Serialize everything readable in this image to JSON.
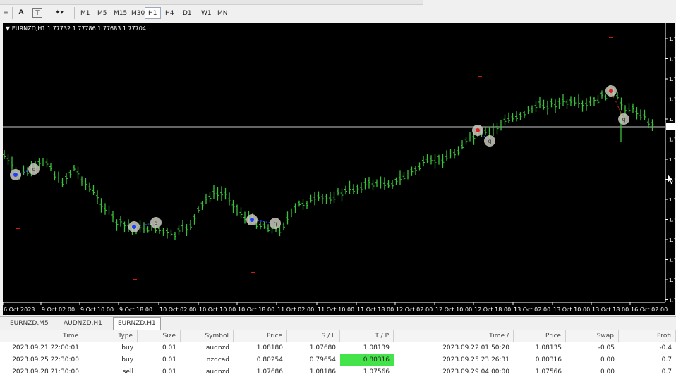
{
  "toolbar": {
    "text_tool": "A",
    "label_tool": "T",
    "periods": [
      "M1",
      "M5",
      "M15",
      "M30",
      "H1",
      "H4",
      "D1",
      "W1",
      "MN"
    ],
    "active_period": "H1"
  },
  "chart": {
    "info": "▼ EURNZD,H1  1.77732 1.77786 1.77683 1.77704",
    "price_axis_label": "1.7",
    "x_labels": [
      "6 Oct 2023",
      "9 Oct 02:00",
      "9 Oct 10:00",
      "9 Oct 18:00",
      "10 Oct 02:00",
      "10 Oct 10:00",
      "10 Oct 18:00",
      "11 Oct 02:00",
      "11 Oct 10:00",
      "11 Oct 18:00",
      "12 Oct 02:00",
      "12 Oct 10:00",
      "12 Oct 18:00",
      "13 Oct 02:00",
      "13 Oct 10:00",
      "13 Oct 18:00",
      "16 Oct 02:00"
    ],
    "bar_color": "#39c339",
    "background": "#000000",
    "trade_marker_labels": [
      "q",
      "q",
      "q",
      "q"
    ]
  },
  "tabs": {
    "items": [
      "EURNZD,M5",
      "AUDNZD,H1",
      "EURNZD,H1"
    ],
    "active": "EURNZD,H1"
  },
  "terminal": {
    "headers": [
      "Time",
      "Type",
      "Size",
      "Symbol",
      "Price",
      "S / L",
      "T / P",
      "Time  /",
      "Price",
      "Swap",
      "Profi"
    ],
    "rows": [
      [
        "2023.09.21 22:00:01",
        "buy",
        "0.01",
        "audnzd",
        "1.08180",
        "1.07680",
        "1.08139",
        "2023.09.22 01:50:20",
        "1.08135",
        "-0.05",
        "-0.4"
      ],
      [
        "2023.09.25 22:30:00",
        "buy",
        "0.01",
        "nzdcad",
        "0.80254",
        "0.79654",
        "0.80316",
        "2023.09.25 23:26:31",
        "0.80316",
        "0.00",
        "0.7"
      ],
      [
        "2023.09.28 21:30:00",
        "sell",
        "0.01",
        "audnzd",
        "1.07686",
        "1.08186",
        "1.07566",
        "2023.09.29 04:00:00",
        "1.07566",
        "0.00",
        "0.7"
      ]
    ],
    "highlight_color": "#44e34a"
  }
}
